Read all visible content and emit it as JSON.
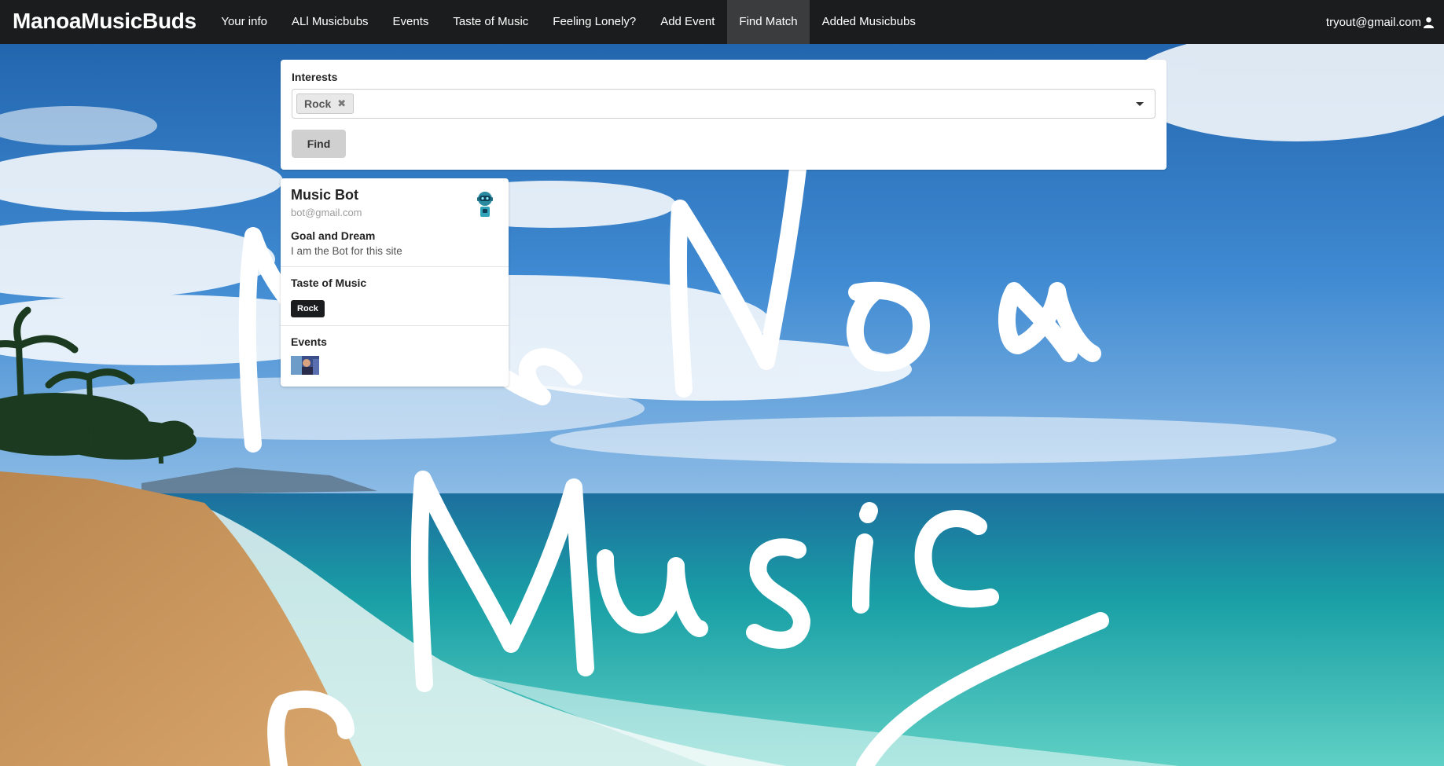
{
  "navbar": {
    "brand": "ManoaMusicBuds",
    "items": [
      {
        "label": "Your info",
        "active": false
      },
      {
        "label": "ALl Musicbubs",
        "active": false
      },
      {
        "label": "Events",
        "active": false
      },
      {
        "label": "Taste of Music",
        "active": false
      },
      {
        "label": "Feeling Lonely?",
        "active": false
      },
      {
        "label": "Add Event",
        "active": false
      },
      {
        "label": "Find Match",
        "active": true
      },
      {
        "label": "Added Musicbubs",
        "active": false
      }
    ],
    "user_email": "tryout@gmail.com",
    "user_icon": "user-icon"
  },
  "search_form": {
    "interests_label": "Interests",
    "selected_interests": [
      "Rock"
    ],
    "find_label": "Find"
  },
  "profile_card": {
    "name": "Music Bot",
    "email": "bot@gmail.com",
    "avatar_icon": "robot-icon",
    "goal_title": "Goal and Dream",
    "goal_text": "I am the Bot for this site",
    "taste_title": "Taste of Music",
    "tags": [
      "Rock"
    ],
    "events_title": "Events"
  },
  "background": {
    "sky_color": "#2f78c4",
    "sea_color": "#1f9aa3",
    "sand_color": "#c9935a",
    "handwriting_color": "#ffffff"
  }
}
